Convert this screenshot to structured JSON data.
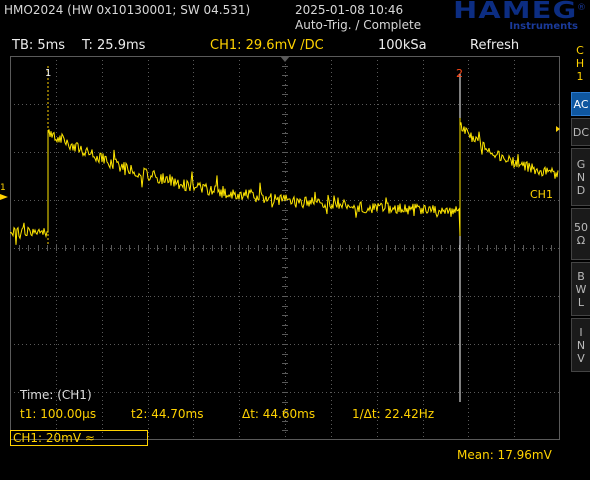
{
  "header": {
    "device_info": "HMO2024 (HW 0x10130001; SW 04.531)",
    "datetime": "2025-01-08 10:46",
    "status": "Auto-Trig. / Complete",
    "logo": "HAMEG",
    "logo_sub": "Instruments",
    "logo_reg": "®"
  },
  "statusbar": {
    "timebase": "TB: 5ms",
    "trigger_time": "T: 25.9ms",
    "channel": "CH1: 29.6mV /DC",
    "sample_rate": "100kSa",
    "mode": "Refresh"
  },
  "sidebar": {
    "channel_label": [
      "C",
      "H",
      "1"
    ],
    "buttons": [
      {
        "label": "AC",
        "lines": [
          "AC"
        ],
        "active": true
      },
      {
        "label": "DC",
        "lines": [
          "DC"
        ],
        "active": false
      },
      {
        "label": "GND",
        "lines": [
          "G",
          "N",
          "D"
        ],
        "active": false
      },
      {
        "label": "50 Ω",
        "lines": [
          "50",
          "Ω"
        ],
        "active": false
      },
      {
        "label": "BWL",
        "lines": [
          "B",
          "W",
          "L"
        ],
        "active": false
      },
      {
        "label": "INV",
        "lines": [
          "I",
          "N",
          "V"
        ],
        "active": false
      }
    ]
  },
  "cursors": {
    "title": "Time: (CH1)",
    "t1": "t1: 100.00µs",
    "t2": "t2: 44.70ms",
    "dt": "Δt: 44.60ms",
    "inv_dt": "1/Δt: 22.42Hz",
    "marker1": "1",
    "marker2": "2"
  },
  "channel_box": "CH1: 20mV ≈",
  "measurement": "Mean: 17.96mV",
  "trace_label": "CH1",
  "colors": {
    "trace": "#ffe600",
    "grid": "#5a5a5a",
    "accent_yellow": "#ffd200",
    "sidebar_active": "#0f57a0",
    "cursor2": "#ff4a1a"
  }
}
